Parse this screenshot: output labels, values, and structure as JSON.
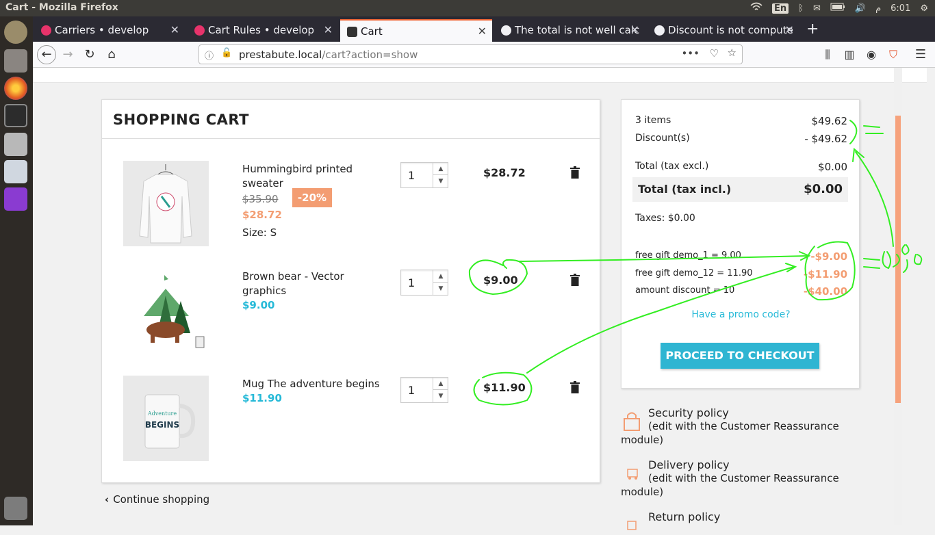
{
  "os": {
    "window_title": "Cart - Mozilla Firefox",
    "lang": "En",
    "clock": "6:01",
    "clock_suffix": "م"
  },
  "tabs": [
    {
      "label": "Carriers • develop",
      "icon": "prestashop-icon"
    },
    {
      "label": "Cart Rules • develop",
      "icon": "prestashop-icon"
    },
    {
      "label": "Cart",
      "icon": "store-icon",
      "active": true
    },
    {
      "label": "The total is not well calc",
      "icon": "github-icon"
    },
    {
      "label": "Discount is not compute",
      "icon": "github-icon"
    }
  ],
  "urlbar": {
    "host": "prestabute.local",
    "path": "/cart?action=show"
  },
  "cart": {
    "title": "SHOPPING CART",
    "items": [
      {
        "name": "Hummingbird printed sweater",
        "regular_price": "$35.90",
        "discount": "-20%",
        "price": "$28.72",
        "size_label": "Size: S",
        "qty": "1",
        "total": "$28.72"
      },
      {
        "name": "Brown bear - Vector graphics",
        "price": "$9.00",
        "qty": "1",
        "total": "$9.00"
      },
      {
        "name": "Mug The adventure begins",
        "price": "$11.90",
        "qty": "1",
        "total": "$11.90"
      }
    ],
    "continue": "Continue shopping"
  },
  "summary": {
    "items_label": "3 items",
    "items_value": "$49.62",
    "discounts_label": "Discount(s)",
    "discounts_value": "- $49.62",
    "total_excl_label": "Total (tax excl.)",
    "total_excl_value": "$0.00",
    "total_incl_label": "Total (tax incl.)",
    "total_incl_value": "$0.00",
    "taxes": "Taxes: $0.00",
    "vouchers": [
      {
        "label": "free gift demo_1 = 9.00",
        "value": "-$9.00"
      },
      {
        "label": "free gift demo_12 = 11.90",
        "value": "-$11.90"
      },
      {
        "label": "amount discount = 10",
        "value": "-$40.00"
      }
    ],
    "promo": "Have a promo code?",
    "checkout": "PROCEED TO CHECKOUT"
  },
  "reassurance": [
    {
      "title": "Security policy",
      "sub": "(edit with the Customer Reassurance",
      "sub2": "module)"
    },
    {
      "title": "Delivery policy",
      "sub": "(edit with the Customer Reassurance",
      "sub2": "module)"
    },
    {
      "title": "Return policy"
    }
  ],
  "colors": {
    "accent": "#25b9d7",
    "discount": "#f39d72",
    "annotation": "#33ee22"
  }
}
